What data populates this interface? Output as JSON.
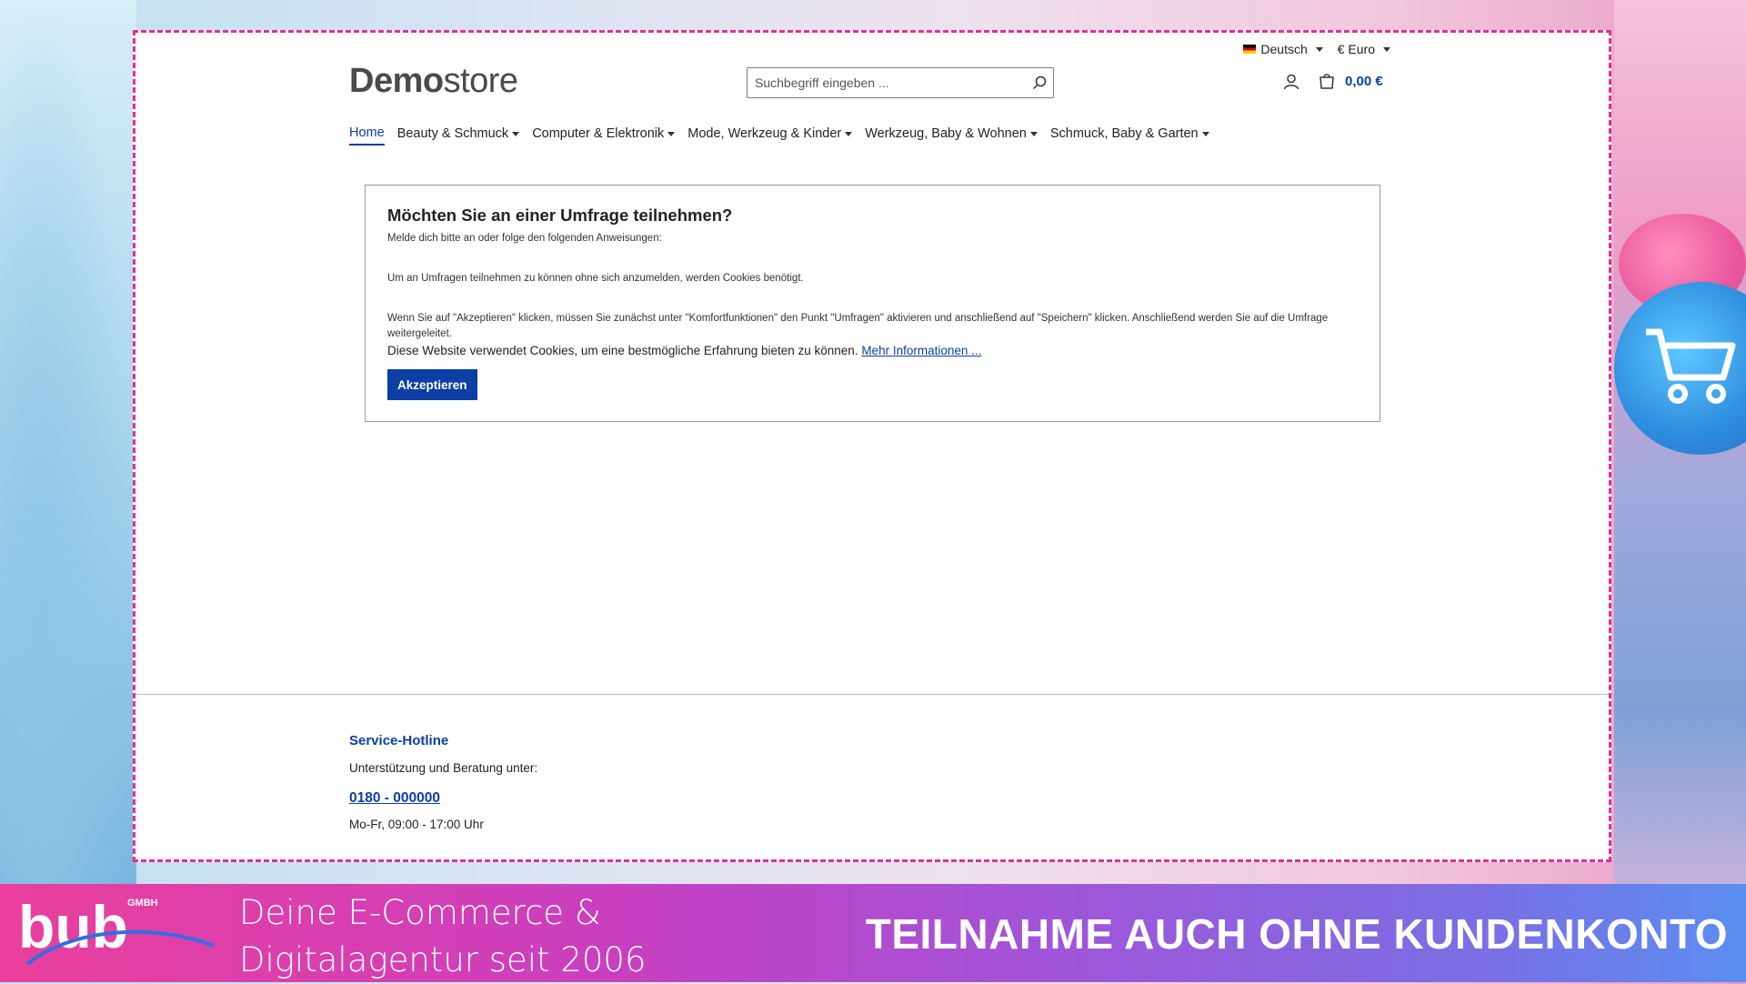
{
  "topbar": {
    "language": "Deutsch",
    "currency": "€ Euro"
  },
  "logo": {
    "bold": "Demo",
    "light": "store"
  },
  "search": {
    "placeholder": "Suchbegriff eingeben ..."
  },
  "cart": {
    "total": "0,00 €"
  },
  "nav": {
    "items": [
      {
        "label": "Home"
      },
      {
        "label": "Beauty & Schmuck"
      },
      {
        "label": "Computer & Elektronik"
      },
      {
        "label": "Mode, Werkzeug & Kinder"
      },
      {
        "label": "Werkzeug, Baby & Wohnen"
      },
      {
        "label": "Schmuck, Baby & Garten"
      }
    ]
  },
  "notice": {
    "title": "Möchten Sie an einer Umfrage teilnehmen?",
    "line1": "Melde dich bitte an oder folge den folgenden Anweisungen:",
    "line2": "Um an Umfragen teilnehmen zu können ohne sich anzumelden, werden Cookies benötigt.",
    "line3": "Wenn Sie auf \"Akzeptieren\" klicken, müssen Sie zunächst unter \"Komfortfunktionen\" den Punkt \"Umfragen\" aktivieren und anschließend auf \"Speichern\" klicken. Anschließend werden Sie auf die Umfrage weitergeleitet.",
    "cookie_text": "Diese Website verwendet Cookies, um eine bestmögliche Erfahrung bieten zu können.",
    "more_link": "Mehr Informationen ...",
    "accept_label": "Akzeptieren"
  },
  "footer": {
    "heading": "Service-Hotline",
    "support": "Unterstützung und Beratung unter:",
    "phone": "0180 - 000000",
    "hours": "Mo-Fr, 09:00 - 17:00 Uhr"
  },
  "banner": {
    "logo_sub": "GMBH",
    "tagline_1": "Deine E-Commerce &",
    "tagline_2": "Digitalagentur seit 2006",
    "headline": "TEILNAHME AUCH OHNE KUNDENKONTO"
  },
  "colors": {
    "accent": "#0b3fa3",
    "frame_border": "#e22e9b"
  }
}
